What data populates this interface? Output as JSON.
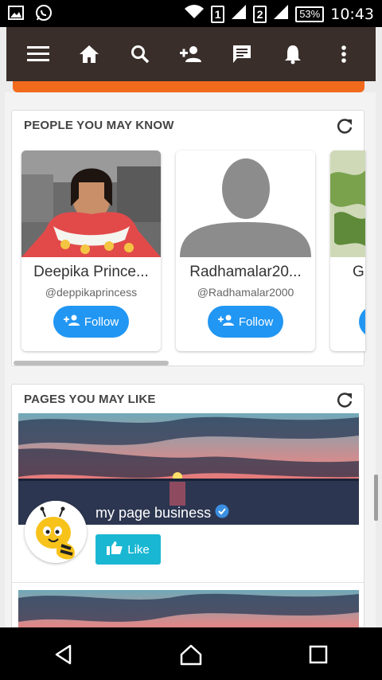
{
  "status_bar": {
    "time": "10:43",
    "battery": "53%",
    "sim1": "1",
    "sim2": "2",
    "icons": [
      "gallery-icon",
      "whatsapp-icon",
      "wifi-icon",
      "signal-icon",
      "signal-icon",
      "battery-icon"
    ]
  },
  "toolbar": {
    "icons": [
      "menu-icon",
      "home-icon",
      "search-icon",
      "add-friend-icon",
      "messages-icon",
      "notifications-icon",
      "more-vert-icon"
    ]
  },
  "people_section": {
    "title": "PEOPLE YOU MAY KNOW",
    "cards": [
      {
        "name": "Deepika Prince...",
        "handle": "@deppikaprincess",
        "button": "Follow"
      },
      {
        "name": "Radhamalar20...",
        "handle": "@Radhamalar2000",
        "button": "Follow"
      },
      {
        "name": "G",
        "handle": "",
        "button": ""
      }
    ]
  },
  "pages_section": {
    "title": "PAGES YOU MAY LIKE",
    "pages": [
      {
        "name": "my page business",
        "button": "Like"
      }
    ]
  },
  "colors": {
    "toolbar": "#3a2e2a",
    "accent_orange": "#f26a1c",
    "follow_blue": "#2196f3",
    "like_cyan": "#1ab7d3"
  }
}
